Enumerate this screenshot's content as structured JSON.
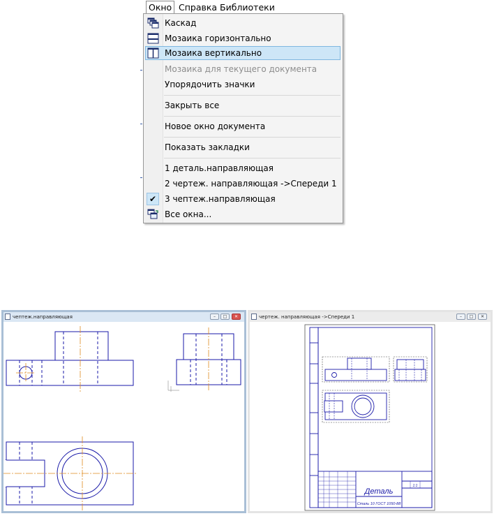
{
  "menubar": {
    "items": [
      {
        "label": "Окно"
      },
      {
        "label": "Справка"
      },
      {
        "label": "Библиотеки"
      }
    ]
  },
  "menu": {
    "items": [
      {
        "label": "Каскад",
        "icon": "cascade-icon"
      },
      {
        "label": "Мозаика горизонтально",
        "icon": "tile-horizontal-icon"
      },
      {
        "label": "Мозаика вертикально",
        "icon": "tile-vertical-icon",
        "highlighted": true
      },
      {
        "label": "Мозаика для текущего документа",
        "disabled": true
      },
      {
        "label": "Упорядочить значки"
      },
      {
        "label": "Закрыть все"
      },
      {
        "label": "Новое окно документа"
      },
      {
        "label": "Показать закладки"
      },
      {
        "label": "1 деталь.направляющая"
      },
      {
        "label": "2 чертеж. направляющая ->Спереди 1"
      },
      {
        "label": "3 чептеж.направляющая",
        "checked": true
      },
      {
        "label": "Все окна...",
        "icon": "all-windows-icon"
      }
    ]
  },
  "windows": {
    "left": {
      "title": "чептеж.направляющая"
    },
    "right": {
      "title": "чертеж. направляющая ->Спереди 1"
    }
  },
  "drawing": {
    "title_block_name": "Деталь",
    "title_block_material": "Сталь 10  ГОСТ 1050-88",
    "scale": "1:1"
  },
  "colors": {
    "menu_highlight": "#cde6f7",
    "drawing_line": "#1a1aa8",
    "axis_line": "#e08a1e",
    "active_window_frame": "#a9bfd6"
  }
}
